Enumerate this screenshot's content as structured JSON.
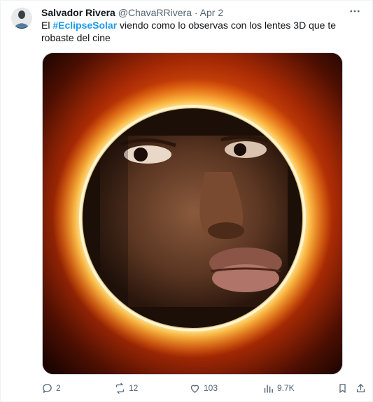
{
  "tweet": {
    "author_name": "Salvador Rivera",
    "author_handle": "@ChavaRRivera",
    "separator": "·",
    "date": "Apr 2",
    "text_before": "El ",
    "hashtag": "#EclipseSolar",
    "text_after": " viendo como lo observas con los lentes 3D que te robaste del cine",
    "media_alt": "Eclipse solar con una cara dentro",
    "actions": {
      "replies": "2",
      "reposts": "12",
      "likes": "103",
      "views": "9.7K"
    }
  },
  "icons": {
    "more": "more-horizontal-icon",
    "reply": "reply-icon",
    "repost": "repost-icon",
    "like": "heart-icon",
    "views": "views-icon",
    "bookmark": "bookmark-icon",
    "share": "share-icon"
  },
  "colors": {
    "hashtag": "#1d9bf0",
    "secondary_text": "#536471"
  }
}
